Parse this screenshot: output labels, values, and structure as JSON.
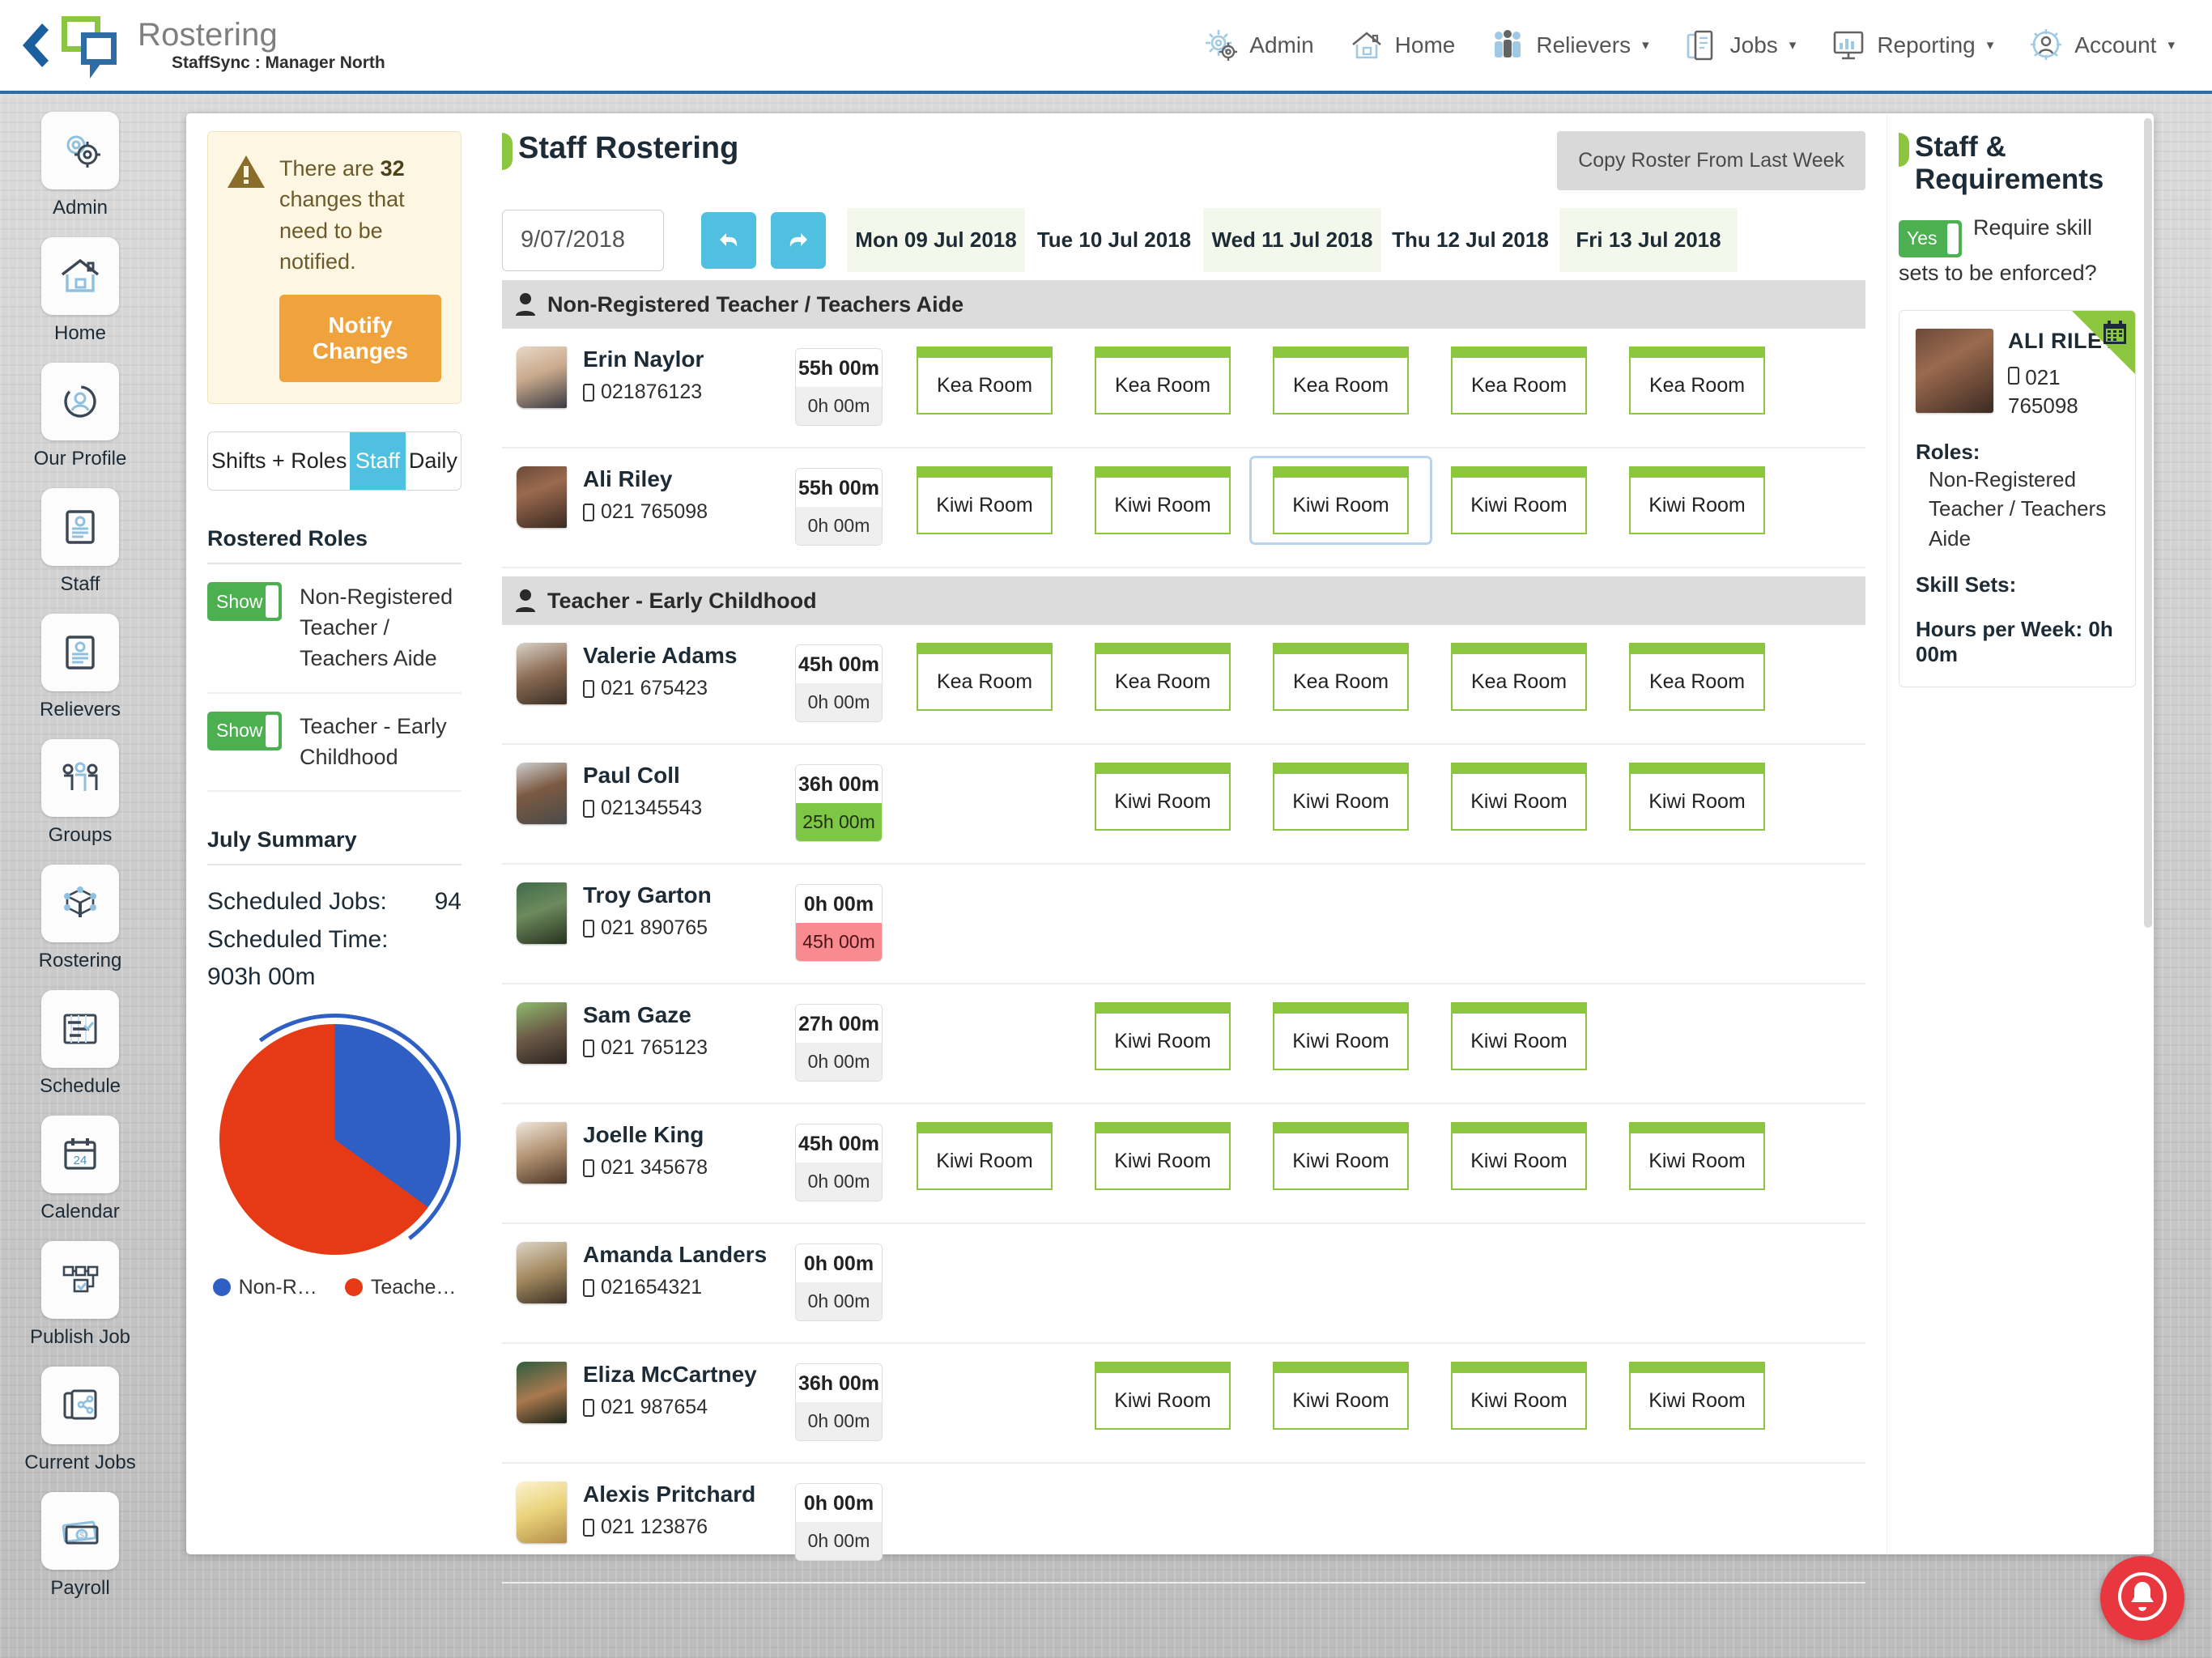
{
  "header": {
    "app_title": "Rostering",
    "app_subtitle": "StaffSync : Manager North",
    "back_icon": "back-chevron-icon",
    "nav": [
      {
        "label": "Admin",
        "icon": "gear-icon",
        "caret": ""
      },
      {
        "label": "Home",
        "icon": "house-icon",
        "caret": ""
      },
      {
        "label": "Relievers",
        "icon": "people-icon",
        "caret": "▾"
      },
      {
        "label": "Jobs",
        "icon": "documents-icon",
        "caret": "▾"
      },
      {
        "label": "Reporting",
        "icon": "monitor-chart-icon",
        "caret": "▾"
      },
      {
        "label": "Account",
        "icon": "gear-person-icon",
        "caret": "▾"
      }
    ]
  },
  "sidebar": {
    "items": [
      {
        "label": "Admin",
        "icon": "gears-icon"
      },
      {
        "label": "Home",
        "icon": "house-icon"
      },
      {
        "label": "Our Profile",
        "icon": "profile-circle-icon"
      },
      {
        "label": "Staff",
        "icon": "id-card-icon"
      },
      {
        "label": "Relievers",
        "icon": "id-card-icon"
      },
      {
        "label": "Groups",
        "icon": "three-people-icon"
      },
      {
        "label": "Rostering",
        "icon": "network-nodes-icon"
      },
      {
        "label": "Schedule",
        "icon": "gantt-icon"
      },
      {
        "label": "Calendar",
        "icon": "calendar-24-icon"
      },
      {
        "label": "Publish Job",
        "icon": "workflow-icon"
      },
      {
        "label": "Current Jobs",
        "icon": "jobs-share-icon"
      },
      {
        "label": "Payroll",
        "icon": "money-icon"
      }
    ]
  },
  "left_panel": {
    "alert": {
      "icon": "warning-triangle-icon",
      "text_before": "There are ",
      "count": "32",
      "text_after": " changes that need to be notified.",
      "button_label": "Notify Changes"
    },
    "tabs": [
      {
        "label": "Shifts + Roles",
        "active": false
      },
      {
        "label": "Staff",
        "active": true
      },
      {
        "label": "Daily",
        "active": false
      }
    ],
    "rostered_roles_title": "Rostered Roles",
    "roles": [
      {
        "toggle_label": "Show",
        "name": "Non-Registered Teacher / Teachers Aide"
      },
      {
        "toggle_label": "Show",
        "name": "Teacher - Early Childhood"
      }
    ],
    "summary_title": "July Summary",
    "summary": {
      "jobs_label": "Scheduled Jobs:",
      "jobs_value": "94",
      "time_label": "Scheduled Time:",
      "time_value": "903h 00m"
    }
  },
  "chart_data": {
    "type": "pie",
    "title": "July Summary",
    "legend_position": "bottom",
    "labels": [
      "Non-R…",
      "Teache…"
    ],
    "full_labels": [
      "Non-Registered Teacher / Teachers Aide",
      "Teacher - Early Childhood"
    ],
    "values": [
      35,
      65
    ],
    "colors": [
      "#2f5fc4",
      "#e63a16"
    ]
  },
  "main": {
    "page_title": "Staff Rostering",
    "copy_roster_label": "Copy Roster From Last Week",
    "date_value": "9/07/2018",
    "date_placeholder": "d/mm/yyyy",
    "prev_icon": "undo-arrow-icon",
    "next_icon": "redo-arrow-icon",
    "days": [
      "Mon 09 Jul 2018",
      "Tue 10 Jul 2018",
      "Wed 11 Jul 2018",
      "Thu 12 Jul 2018",
      "Fri 13 Jul 2018"
    ],
    "groups": [
      {
        "name": "Non-Registered Teacher / Teachers Aide",
        "staff": [
          {
            "name": "Erin Naylor",
            "phone": "021876123",
            "hours_top": "55h 00m",
            "hours_bottom": "0h 00m",
            "hours_state": "neutral",
            "cells": [
              "Kea Room",
              "Kea Room",
              "Kea Room",
              "Kea Room",
              "Kea Room"
            ],
            "selected_index": -1
          },
          {
            "name": "Ali Riley",
            "phone": "021 765098",
            "hours_top": "55h 00m",
            "hours_bottom": "0h 00m",
            "hours_state": "neutral",
            "cells": [
              "Kiwi Room",
              "Kiwi Room",
              "Kiwi Room",
              "Kiwi Room",
              "Kiwi Room"
            ],
            "selected_index": 2
          }
        ]
      },
      {
        "name": "Teacher - Early Childhood",
        "staff": [
          {
            "name": "Valerie Adams",
            "phone": "021 675423",
            "hours_top": "45h 00m",
            "hours_bottom": "0h 00m",
            "hours_state": "neutral",
            "cells": [
              "Kea Room",
              "Kea Room",
              "Kea Room",
              "Kea Room",
              "Kea Room"
            ],
            "selected_index": -1
          },
          {
            "name": "Paul Coll",
            "phone": "021345543",
            "hours_top": "36h 00m",
            "hours_bottom": "25h 00m",
            "hours_state": "green",
            "cells": [
              "",
              "Kiwi Room",
              "Kiwi Room",
              "Kiwi Room",
              "Kiwi Room"
            ],
            "selected_index": -1
          },
          {
            "name": "Troy Garton",
            "phone": "021 890765",
            "hours_top": "0h 00m",
            "hours_bottom": "45h 00m",
            "hours_state": "red",
            "cells": [
              "",
              "",
              "",
              "",
              ""
            ],
            "selected_index": -1
          },
          {
            "name": "Sam Gaze",
            "phone": "021 765123",
            "hours_top": "27h 00m",
            "hours_bottom": "0h 00m",
            "hours_state": "neutral",
            "cells": [
              "",
              "Kiwi Room",
              "Kiwi Room",
              "Kiwi Room",
              ""
            ],
            "selected_index": -1
          },
          {
            "name": "Joelle King",
            "phone": "021 345678",
            "hours_top": "45h 00m",
            "hours_bottom": "0h 00m",
            "hours_state": "neutral",
            "cells": [
              "Kiwi Room",
              "Kiwi Room",
              "Kiwi Room",
              "Kiwi Room",
              "Kiwi Room"
            ],
            "selected_index": -1
          },
          {
            "name": "Amanda Landers",
            "phone": "021654321",
            "hours_top": "0h 00m",
            "hours_bottom": "0h 00m",
            "hours_state": "neutral",
            "cells": [
              "",
              "",
              "",
              "",
              ""
            ],
            "selected_index": -1
          },
          {
            "name": "Eliza McCartney",
            "phone": "021 987654",
            "hours_top": "36h 00m",
            "hours_bottom": "0h 00m",
            "hours_state": "neutral",
            "cells": [
              "",
              "Kiwi Room",
              "Kiwi Room",
              "Kiwi Room",
              "Kiwi Room"
            ],
            "selected_index": -1
          },
          {
            "name": "Alexis Pritchard",
            "phone": "021 123876",
            "hours_top": "0h 00m",
            "hours_bottom": "0h 00m",
            "hours_state": "neutral",
            "cells": [
              "",
              "",
              "",
              "",
              ""
            ],
            "selected_index": -1
          }
        ]
      }
    ]
  },
  "right_panel": {
    "title": "Staff & Requirements",
    "enforce_toggle_label": "Yes",
    "enforce_question": "Require skill sets to be enforced?",
    "staff_card": {
      "name": "ALI RILEY",
      "phone": "021 765098",
      "roles_label": "Roles:",
      "roles_value": "Non-Registered Teacher / Teachers Aide",
      "skillsets_label": "Skill Sets:",
      "skillsets_value": "",
      "hours_label": "Hours per Week: 0h 00m",
      "corner_icon": "calendar-icon"
    }
  },
  "fab": {
    "icon": "bell-icon",
    "color": "#e8373f"
  },
  "colors": {
    "brand_blue": "#2e6ca4",
    "brand_green": "#8cc63f",
    "accent_cyan": "#4fc0e0",
    "warning_orange": "#f0a33c",
    "toggle_green": "#4caf50",
    "danger_red": "#e8373f"
  }
}
